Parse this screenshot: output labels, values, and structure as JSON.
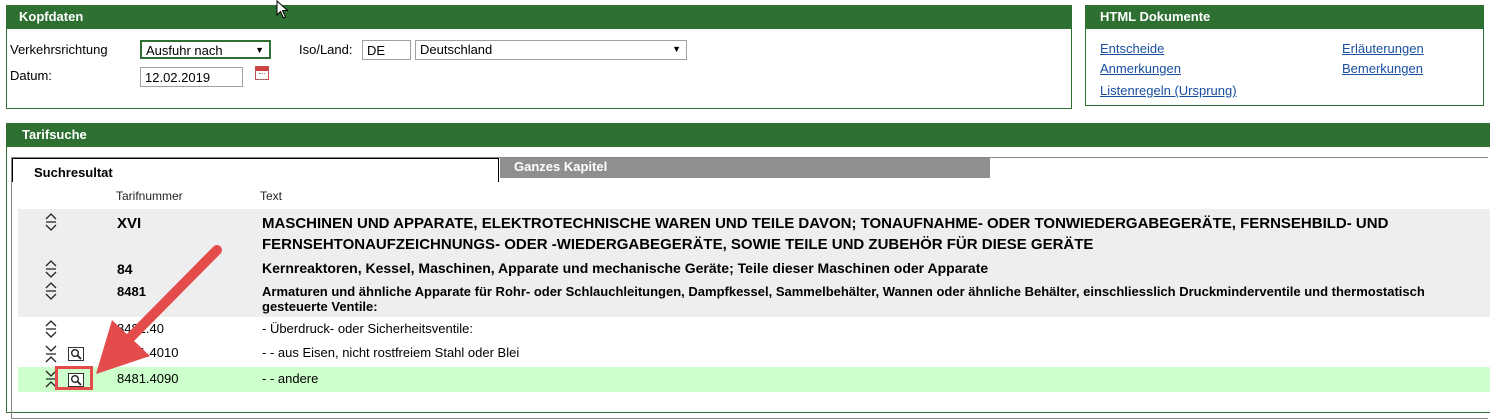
{
  "kopfdaten": {
    "title": "Kopfdaten",
    "verkehrsrichtung_label": "Verkehrsrichtung",
    "verkehrsrichtung_value": "Ausfuhr nach",
    "datum_label": "Datum:",
    "datum_value": "12.02.2019",
    "iso_label": "Iso/Land:",
    "iso_value": "DE",
    "land_value": "Deutschland"
  },
  "html_dokumente": {
    "title": "HTML Dokumente",
    "links": [
      "Entscheide",
      "Erläuterungen",
      "Anmerkungen",
      "Bemerkungen",
      "Listenregeln (Ursprung)"
    ]
  },
  "tarifsuche": {
    "title": "Tarifsuche",
    "tab_active": "Suchresultat",
    "tab_inactive": "Ganzes Kapitel",
    "col_tarifnummer": "Tarifnummer",
    "col_text": "Text",
    "rows": [
      {
        "num": "XVI",
        "text": "MASCHINEN UND APPARATE, ELEKTROTECHNISCHE WAREN UND TEILE DAVON; TONAUFNAHME- ODER TONWIEDERGABEGERÄTE, FERNSEHBILD- UND FERNSEHTONAUFZEICHNUNGS- ODER -WIEDERGABEGERÄTE, SOWIE TEILE UND ZUBEHÖR FÜR DIESE GERÄTE"
      },
      {
        "num": "84",
        "text": "Kernreaktoren, Kessel, Maschinen, Apparate und mechanische Geräte; Teile dieser Maschinen oder Apparate"
      },
      {
        "num": "8481",
        "text": "Armaturen und ähnliche Apparate für Rohr- oder Schlauchleitungen, Dampfkessel, Sammelbehälter, Wannen oder ähnliche Behälter, einschliesslich Druckminderventile und thermostatisch gesteuerte Ventile:"
      },
      {
        "num": "8481.40",
        "text": "-  Überdruck- oder Sicherheitsventile:"
      },
      {
        "num": "8481.4010",
        "text": "- -  aus Eisen, nicht rostfreiem Stahl oder Blei"
      },
      {
        "num": "8481.4090",
        "text": "- -  andere"
      }
    ]
  },
  "colors": {
    "header_green": "#2e7032",
    "link_blue": "#1a4fa0",
    "row_gray": "#eeeeee",
    "row_green": "#ccffcc",
    "annotation_red": "#e44b4b"
  },
  "icons": [
    "expand-collapse-icon",
    "collapse-icon",
    "magnifier-detail-icon",
    "calendar-icon",
    "mouse-cursor-icon"
  ]
}
